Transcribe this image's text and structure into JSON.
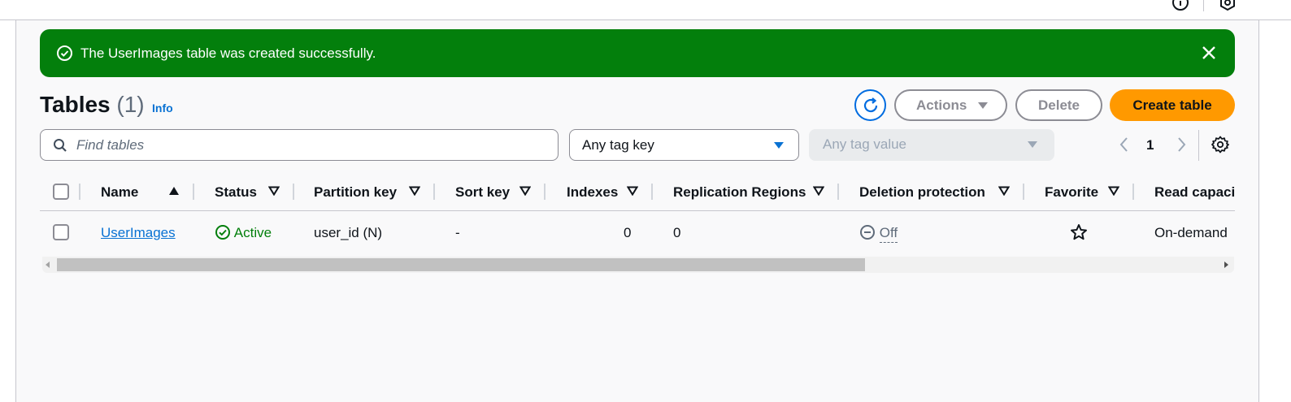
{
  "flash": {
    "message": "The UserImages table was created successfully."
  },
  "header": {
    "title": "Tables",
    "count": "(1)",
    "info_label": "Info",
    "actions_label": "Actions",
    "delete_label": "Delete",
    "create_label": "Create table"
  },
  "filters": {
    "search_placeholder": "Find tables",
    "tag_key_value": "Any tag key",
    "tag_value_placeholder": "Any tag value"
  },
  "pagination": {
    "current_page": "1"
  },
  "table": {
    "columns": [
      "Name",
      "Status",
      "Partition key",
      "Sort key",
      "Indexes",
      "Replication Regions",
      "Deletion protection",
      "Favorite",
      "Read capacit"
    ],
    "sorted_column": "Name",
    "rows": [
      {
        "name": "UserImages",
        "status": "Active",
        "partition_key": "user_id (N)",
        "sort_key": "-",
        "indexes": "0",
        "replication_regions": "0",
        "deletion_protection": "Off",
        "favorite": "star-outline",
        "read_capacity": "On-demand"
      }
    ]
  },
  "colors": {
    "success_green": "#037f0c",
    "primary_orange": "#ff9900",
    "link_blue": "#0972d3",
    "disabled_gray": "#8c8c94"
  },
  "icons": [
    "success-check-icon",
    "close-icon",
    "refresh-icon",
    "caret-down-icon",
    "search-icon",
    "chevron-left-icon",
    "chevron-right-icon",
    "settings-gear-icon",
    "sort-asc-icon",
    "filter-sort-icon",
    "status-check-icon",
    "minus-circle-icon",
    "star-icon"
  ]
}
